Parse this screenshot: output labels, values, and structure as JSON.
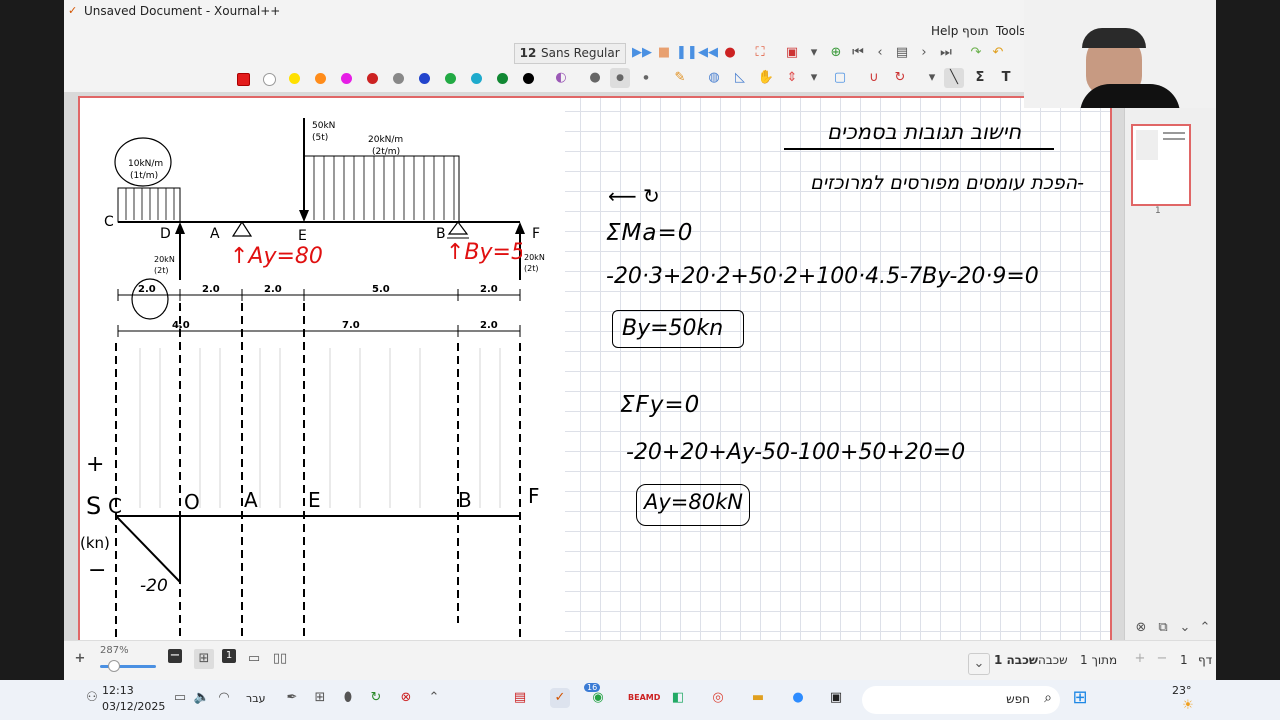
{
  "window": {
    "title": "Unsaved Document - Xournal++"
  },
  "menu": {
    "help": "Help",
    "tosef": "תוסף",
    "tools": "Tools"
  },
  "toolbar": {
    "font_size": "12",
    "font_name": "Sans Regular"
  },
  "colors": {
    "accent": "#e06666",
    "swatches": [
      "#e31b1b",
      "#ffffff",
      "#ffe000",
      "#ff8c1a",
      "#e61ee6",
      "#cc2222",
      "#888888",
      "#2244cc",
      "#22aa44",
      "#1eaacc",
      "#118833",
      "#000000"
    ]
  },
  "icons": [
    "layer-icon",
    "pdf-icon",
    "play-icon",
    "pause-icon",
    "prev-icon",
    "record-icon",
    "fullscreen-icon",
    "delete-icon",
    "add-page-icon",
    "first-page-icon",
    "back-icon",
    "next-icon",
    "last-page-icon",
    "redo-icon",
    "undo-icon",
    "pen-icon",
    "eraser-icon",
    "highlighter-icon",
    "text-icon",
    "hand-icon",
    "select-icon",
    "shape-icon",
    "sum-icon"
  ],
  "drawing": {
    "loads": {
      "point_load": "50kN",
      "point_load_t": "(5t)",
      "udl_right": "20kN/m",
      "udl_right_t": "(2t/m)",
      "udl_left": "10kN/m",
      "udl_left_t": "(1t/m)",
      "reaction_d": "20kN",
      "reaction_d_t": "(2t)",
      "reaction_f": "20kN",
      "reaction_f_t": "(2t)"
    },
    "points": {
      "c": "C",
      "d": "D",
      "a": "A",
      "e": "E",
      "b": "B",
      "f": "F"
    },
    "reactions": {
      "ay": "↑Ay=80",
      "by": "↑By=50"
    },
    "dims1": [
      "2.0",
      "2.0",
      "2.0",
      "5.0",
      "2.0"
    ],
    "dims2": [
      "4.0",
      "7.0",
      "2.0"
    ],
    "sfd": {
      "plus": "+",
      "s": "S",
      "kn": "(kn)",
      "minus": "−",
      "c": "C",
      "o": "O",
      "a": "A",
      "e": "E",
      "b": "B",
      "f": "F",
      "value": "-20"
    }
  },
  "notes": {
    "title": "חישוב תגובות בסמכים",
    "subtitle": "-הפכת עומסים מפורסים למרוכזים",
    "moment_label": "ΣMa=0",
    "eq1": "-20·3+20·2+50·2+100·4.5-7By-20·9=0",
    "result1": "By=50kn",
    "fy_label": "ΣFy=0",
    "eq2": "-20+20+Ay-50-100+50+20=0",
    "result2": "Ay=80kN"
  },
  "sidebar": {
    "page_num": "1"
  },
  "status": {
    "zoom": "287%",
    "page_label": "דף",
    "page_value": "1",
    "of_total": "מתוך 1",
    "layer_label": "שכבה",
    "layer_value": "שכבה 1"
  },
  "taskbar": {
    "time": "12:13",
    "date": "03/12/2025",
    "lang": "עבר",
    "search": "חפש",
    "weather": "23°",
    "badge": "16"
  }
}
